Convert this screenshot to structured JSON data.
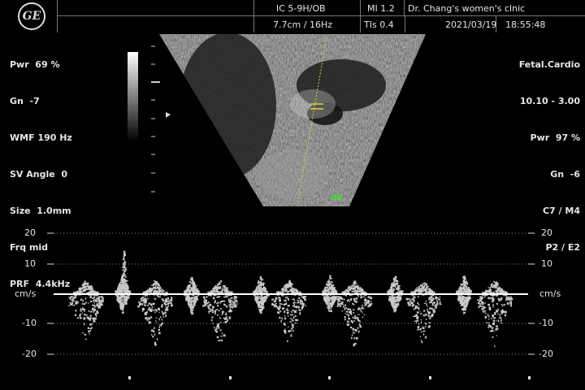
{
  "header": {
    "logo_text": "GE",
    "probe": "IC 5-9H/OB",
    "depth_freq": "7.7cm / 16Hz",
    "mi": "MI  1.2",
    "tis": "TIs  0.4",
    "clinic": "Dr. Chang's women's clnic",
    "date": "2021/03/19",
    "time": "18:55:48"
  },
  "left_params": [
    "Pwr  69 %",
    "Gn  -7",
    "WMF 190 Hz",
    "SV Angle  0",
    "Size  1.0mm",
    "Frq mid",
    "PRF  4.4kHz"
  ],
  "right_params": [
    "Fetal.Cardio",
    "10.10 - 3.00",
    "Pwr  97 %",
    "Gn  -6",
    "C7 / M4",
    "P2 / E2"
  ],
  "bmode_label": "GE",
  "doppler": {
    "unit": "cm/s",
    "ticks_left": [
      "20",
      "10",
      "-10",
      "-20"
    ],
    "ticks_right": [
      "20",
      "10",
      "-10",
      "-20"
    ]
  },
  "colors": {
    "text": "#e6e6e6",
    "accent_green": "#37e23a",
    "gate": "#d8d840"
  }
}
